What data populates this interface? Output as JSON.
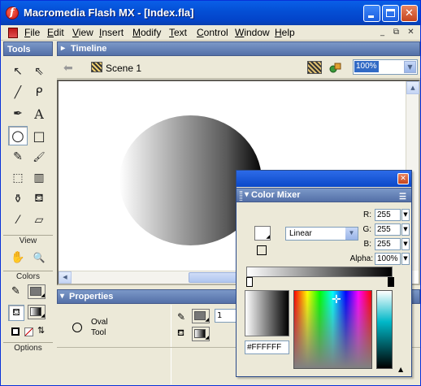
{
  "window": {
    "title": "Macromedia Flash MX - [Index.fla]",
    "min_label": "",
    "max_label": "",
    "close_label": "✕"
  },
  "menubar": {
    "items": [
      "File",
      "Edit",
      "View",
      "Insert",
      "Modify",
      "Text",
      "Control",
      "Window",
      "Help"
    ],
    "doc_min": "_",
    "doc_restore": "⧉",
    "doc_close": "✕"
  },
  "tools_panel": {
    "title": "Tools",
    "tools": [
      {
        "name": "arrow-tool",
        "glyph": "↖"
      },
      {
        "name": "subselect-tool",
        "glyph": "⇖"
      },
      {
        "name": "line-tool",
        "glyph": "╱"
      },
      {
        "name": "lasso-tool",
        "glyph": "ᑭ"
      },
      {
        "name": "pen-tool",
        "glyph": "✒"
      },
      {
        "name": "text-tool",
        "glyph": "A"
      },
      {
        "name": "oval-tool",
        "glyph": "○"
      },
      {
        "name": "rectangle-tool",
        "glyph": "□"
      },
      {
        "name": "pencil-tool",
        "glyph": "✎"
      },
      {
        "name": "brush-tool",
        "glyph": "🖌"
      },
      {
        "name": "free-transform-tool",
        "glyph": "⬚"
      },
      {
        "name": "fill-transform-tool",
        "glyph": "▥"
      },
      {
        "name": "ink-bottle-tool",
        "glyph": "⚱"
      },
      {
        "name": "paint-bucket-tool",
        "glyph": "⛾"
      },
      {
        "name": "eyedropper-tool",
        "glyph": "⁄"
      },
      {
        "name": "eraser-tool",
        "glyph": "▱"
      }
    ],
    "view_label": "View",
    "view_tools": [
      {
        "name": "hand-tool",
        "glyph": "✋"
      },
      {
        "name": "zoom-tool",
        "glyph": "🔍"
      }
    ],
    "colors_label": "Colors",
    "options_label": "Options"
  },
  "timeline": {
    "title": "Timeline"
  },
  "scene_bar": {
    "scene_name": "Scene 1",
    "zoom_value": "100%"
  },
  "properties": {
    "title": "Properties",
    "tool_name_line1": "Oval",
    "tool_name_line2": "Tool",
    "stroke_height": "1"
  },
  "color_mixer": {
    "title": "Color Mixer",
    "fill_type": "Linear",
    "r_label": "R:",
    "g_label": "G:",
    "b_label": "B:",
    "alpha_label": "Alpha:",
    "r_value": "255",
    "g_value": "255",
    "b_value": "255",
    "alpha_value": "100%",
    "hex_value": "#FFFFFF"
  },
  "colors": {
    "title_bar": "#0a5fe8",
    "panel_header": "#6a86bb",
    "chrome": "#ece9d8"
  }
}
